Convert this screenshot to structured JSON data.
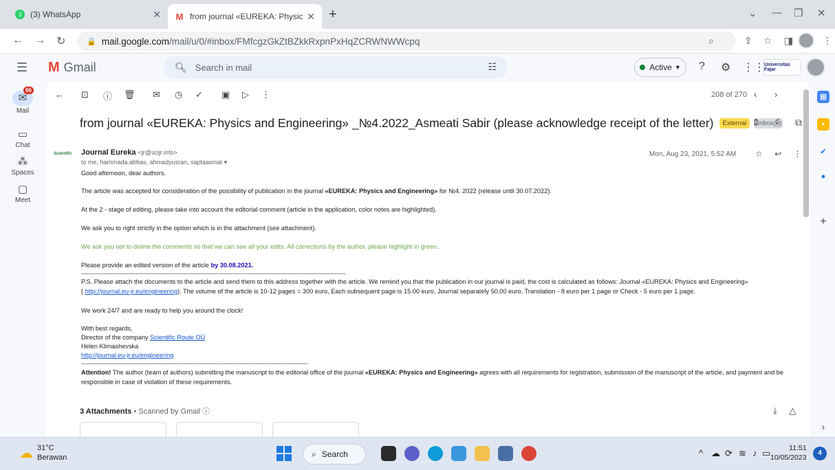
{
  "tabs": [
    {
      "title": "(3) WhatsApp",
      "badge": "3"
    },
    {
      "title": "from journal «EUREKA: Physics an"
    }
  ],
  "address": {
    "host": "mail.google.com",
    "path": "/mail/u/0/#inbox/FMfcgzGkZtBZkkRxpnPxHqZCRWNWWcpq"
  },
  "gmail": {
    "logo_text": "Gmail",
    "search_placeholder": "Search in mail",
    "status": "Active",
    "org_badge": "Universitas Fajar"
  },
  "rail": {
    "mail": "Mail",
    "mail_badge": "66",
    "chat": "Chat",
    "spaces": "Spaces",
    "meet": "Meet"
  },
  "toolbar": {
    "counter": "208 of 270"
  },
  "email": {
    "subject": "from journal «EUREKA: Physics and Engineering» _№4.2022_Asmeati Sabir (please acknowledge receipt of the letter)",
    "label_external": "External",
    "label_inbox": "Inbox ×",
    "sender_logo": "Scientific",
    "sender_name": "Journal Eureka",
    "sender_addr": "<jr@scijr.info>",
    "recipients": "to me, hammada.abbas, ahmadyusran, saptaasmal ▾",
    "date": "Mon, Aug 23, 2021, 5:52 AM",
    "greeting": "Good afternoon, dear authors.",
    "p1a": "The article was accepted for consideration of the possibility of publication in the journal ",
    "p1b": "«EUREKA: Physics and Engineering»",
    "p1c": " for №4. 2022 (release until 30.07.2022).",
    "p2": "At the 2 - stage of editing, please take into account the editorial comment  (article in the application, color notes are highlighted).",
    "p3": "We ask you to right strictly in the option which is in the attachment (see attachment).",
    "p4": "We ask you not to delete the comments so that we can see all your edits. All corrections by the author, please highlight in green.",
    "p5a": "Please provide an edited version of the article ",
    "p5b": "by 30.08.2021.",
    "divider": "------------------------------------------------------------------------------------------------------------------------------------------------------",
    "ps1": "P.S. Please attach the documents to the article and send them to this address together with the article. We remind you that the publication in our journal is paid, the cost is calculated as follows: Journal «EUREKA: Physics and Engineering»",
    "ps2a": "( ",
    "ps2link": "http://journal.eu-jr.eu/engineering",
    "ps2b": "). The volume of the article is 10-12 pages = 300 euro, Each subsequent page is 15.00 euro, Journal separately 50,00 euro, Translation - 8 euro per 1 page or Check - 5 euro per 1 page.",
    "p6": "We work 24/7 and are ready to help you around the clock!",
    "sig1": "With best regards,",
    "sig2a": "Director of the company ",
    "sig2link": "Scientific Route OÜ",
    "sig3": "Helen Klimashevska",
    "sig4": "http://journal.eu-jr.eu/engineering",
    "divider2": "---------------------------------------------------------------------------------------------------------------------------------",
    "att1": "Attention!",
    "att2": " The author (team of authors) submitting the manuscript to the editorial office of the journal  ",
    "att3": "«EUREKA: Physics and Engineering»",
    "att4": "  agrees with all requirements for registration, submission of the manuscript of the article, and payment and be",
    "att5": "responsible in case of violation of these requirements.",
    "attachments_count": "3 Attachments",
    "scanned": " • Scanned by Gmail ⓘ"
  },
  "taskbar": {
    "temp": "31°C",
    "weather": "Berawan",
    "search": "Search",
    "time": "11:51",
    "date": "10/05/2023",
    "notif": "4"
  },
  "colors": {
    "gmail_red": "#ea4335",
    "green_text": "#6aa84f",
    "external_label": "#f9d94f",
    "active_green": "#188038"
  }
}
